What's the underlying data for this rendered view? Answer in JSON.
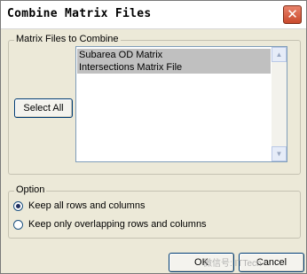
{
  "window": {
    "title": "Combine Matrix Files",
    "close_glyph": "✕"
  },
  "files_group": {
    "label": "Matrix Files to Combine",
    "select_all_label": "Select All",
    "items": [
      {
        "label": "Subarea OD Matrix",
        "selected": true
      },
      {
        "label": "Intersections Matrix File",
        "selected": true
      }
    ],
    "scroll_up_glyph": "▲",
    "scroll_down_glyph": "▼"
  },
  "option_group": {
    "label": "Option",
    "options": [
      {
        "label": "Keep all rows and columns",
        "checked": true
      },
      {
        "label": "Keep only overlapping rows and columns",
        "checked": false
      }
    ]
  },
  "buttons": {
    "ok_label": "OK",
    "cancel_label": "Cancel"
  },
  "watermark": {
    "text": "微信号: ITTech"
  },
  "colors": {
    "dialog_bg": "#ece9d8",
    "selection_bg": "#c0c0c0",
    "close_button": "#c9492c",
    "button_border": "#003c74"
  },
  "icons": {
    "close": "close-icon",
    "scroll_up": "arrow-up-icon",
    "scroll_down": "arrow-down-icon"
  }
}
